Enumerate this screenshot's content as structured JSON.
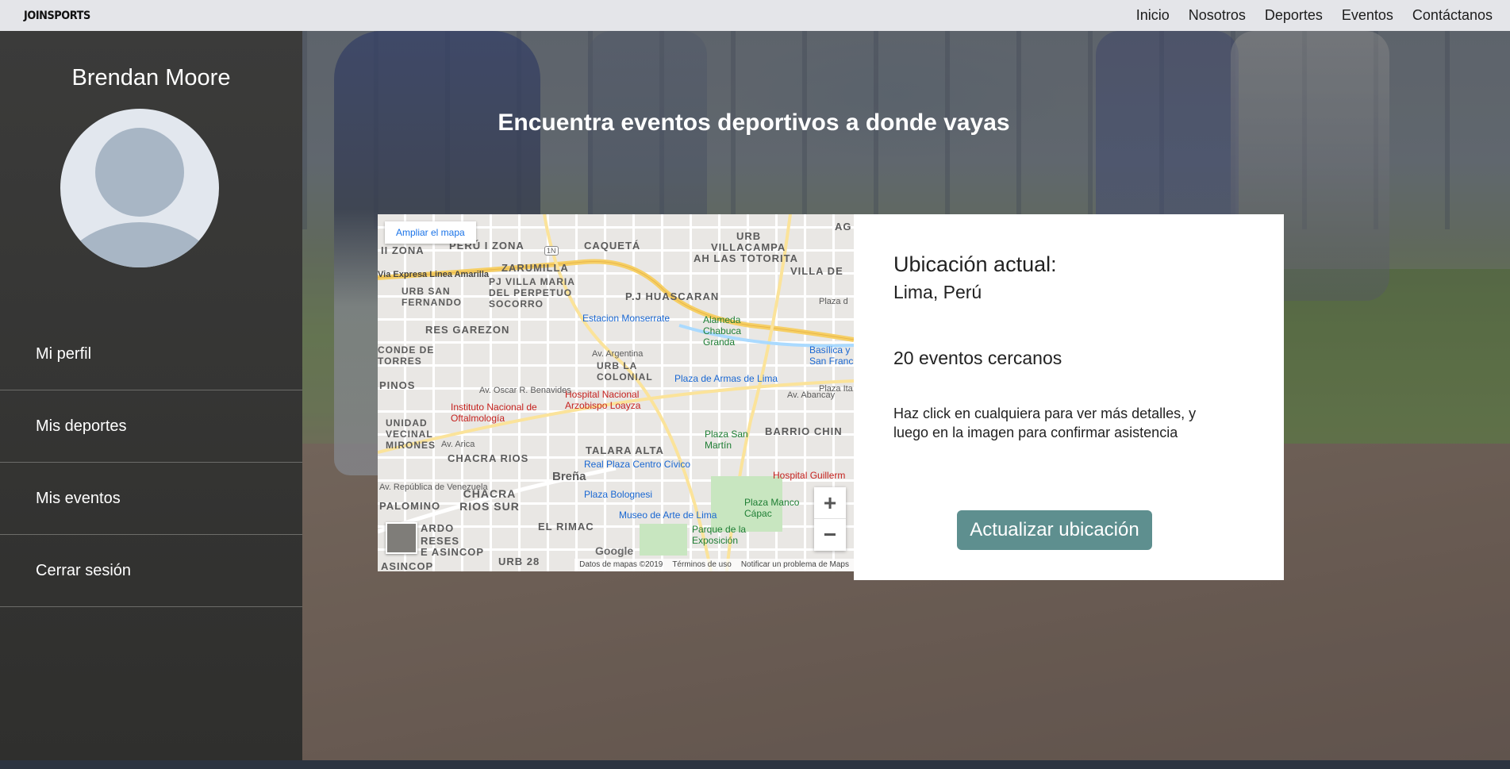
{
  "nav": {
    "brand": "JOINSPORTS",
    "links": [
      "Inicio",
      "Nosotros",
      "Deportes",
      "Eventos",
      "Contáctanos"
    ]
  },
  "sidebar": {
    "username": "Brendan Moore",
    "menu": [
      "Mi perfil",
      "Mis deportes",
      "Mis eventos",
      "Cerrar sesión"
    ]
  },
  "headline": "Encuentra eventos deportivos a donde vayas",
  "map": {
    "expand_label": "Ampliar el mapa",
    "zoom_in": "+",
    "zoom_out": "−",
    "logo": "Google",
    "footer": [
      "Datos de mapas ©2019",
      "Términos de uso",
      "Notificar un problema de Maps"
    ],
    "labels": {
      "l1": "URB",
      "l2": "VILLACAMPA",
      "l3": "AH LAS TOTORITA",
      "l4": "CAQUETÁ",
      "l5": "PERÚ I ZONA",
      "l6": "II ZONA",
      "l7": "ZARUMILLA",
      "l8": "PJ VILLA MARIA DEL PERPETUO SOCORRO",
      "l9": "URB SAN FERNANDO",
      "l10": "P.J HUASCARAN",
      "l11": "VILLA DE",
      "l12": "RES GAREZON",
      "l13": "Estacion Monserrate",
      "l14": "Alameda Chabuca Granda",
      "l15": "CONDE DE TORRES",
      "l16": "URB LA COLONIAL",
      "l17": "Plaza de Armas de Lima",
      "l18": "Basílica y San Franc",
      "l19": "PINOS",
      "l20": "Hospital Nacional Arzobispo Loayza",
      "l21": "Instituto Nacional de Oftalmología",
      "l22": "UNIDAD VECINAL MIRONES",
      "l23": "CHACRA RIOS",
      "l24": "TALARA ALTA",
      "l25": "Plaza San Martín",
      "l26": "BARRIO CHIN",
      "l27": "Real Plaza Centro Cívico",
      "l28": "Breña",
      "l29": "Hospital Guillerm",
      "l30": "PALOMINO",
      "l31": "CHACRA RIOS SUR",
      "l32": "Plaza Bolognesi",
      "l33": "Museo de Arte de Lima",
      "l34": "Plaza Manco Cápac",
      "l35": "EL RIMAC",
      "l36": "Parque de la Exposición",
      "l37": "URB 28",
      "l38": "Via Expresa Linea Amarilla",
      "l39": "Av. Argentina",
      "l40": "Av. Oscar R. Benavides",
      "l41": "Av. Arica",
      "l42": "Av. República de Venezuela",
      "l43": "Av. Abancay",
      "l44": "Plaza d",
      "l45": "Plaza Ita",
      "l46": "1N",
      "l47": "ARDO",
      "l48": "RESES",
      "l49": "E ASINCOP",
      "l50": "ASINCOP",
      "l51": "AG"
    }
  },
  "info": {
    "label": "Ubicación actual:",
    "city": "Lima, Perú",
    "count": "20 eventos cercanos",
    "help": "Haz click en cualquiera para ver más detalles, y luego en la imagen para confirmar asistencia",
    "button": "Actualizar ubicación"
  },
  "colors": {
    "button": "#5e8f8f",
    "sidebar": "#2f2f2d",
    "nav": "#e4e5e9"
  }
}
